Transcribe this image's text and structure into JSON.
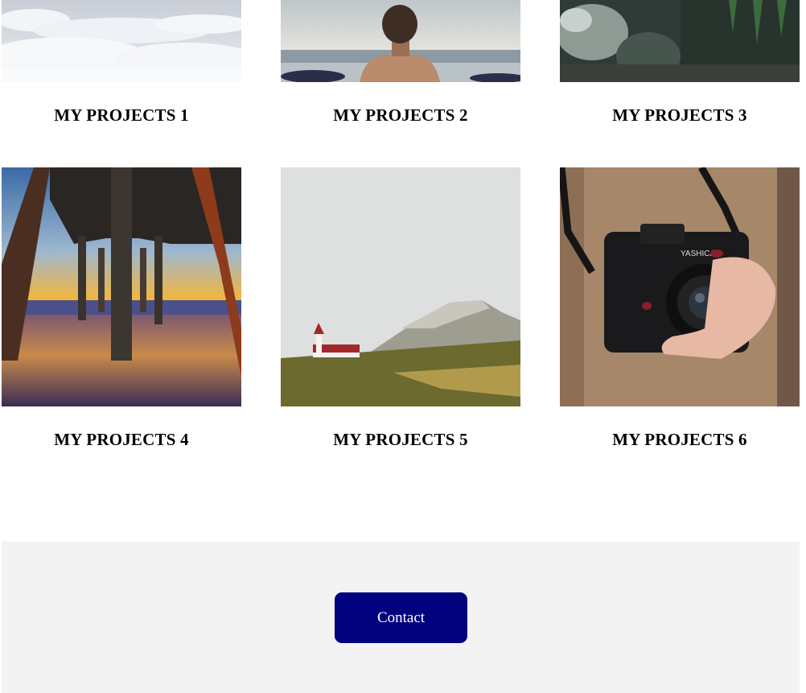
{
  "projects": [
    {
      "title": "My Projects 1",
      "image": "clouds-above-photo"
    },
    {
      "title": "My Projects 2",
      "image": "man-back-sea-photo"
    },
    {
      "title": "My Projects 3",
      "image": "forest-rocks-photo"
    },
    {
      "title": "My Projects 4",
      "image": "pier-sunset-photo"
    },
    {
      "title": "My Projects 5",
      "image": "church-mountain-photo"
    },
    {
      "title": "My Projects 6",
      "image": "camera-hands-photo"
    }
  ],
  "footer": {
    "contact_label": "Contact",
    "button_color": "#02027f",
    "background": "#f3f3f3"
  }
}
